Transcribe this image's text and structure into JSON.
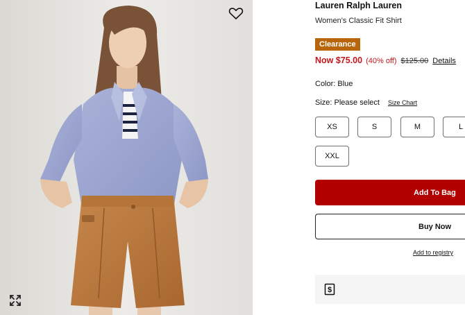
{
  "product": {
    "brand": "Lauren Ralph Lauren",
    "name": "Women's Classic Fit Shirt",
    "badge": "Clearance",
    "badge_color": "#b8660b",
    "price_now": "Now $75.00",
    "price_discount": "(40% off)",
    "price_was": "$125.00",
    "details_link": "Details",
    "color_label": "Color: Blue",
    "size_label": "Size: Please select",
    "size_chart_link": "Size Chart",
    "sizes": [
      "XS",
      "S",
      "M",
      "L",
      "XXL"
    ]
  },
  "actions": {
    "add_to_bag": "Add To Bag",
    "buy_now": "Buy Now",
    "add_to_registry": "Add to registry"
  },
  "icons": {
    "favorite": "heart-outline-icon",
    "expand": "expand-arrows-icon",
    "promo": "dollar-tag-icon"
  },
  "colors": {
    "accent_red": "#b20000",
    "sale_red": "#c2171c"
  }
}
